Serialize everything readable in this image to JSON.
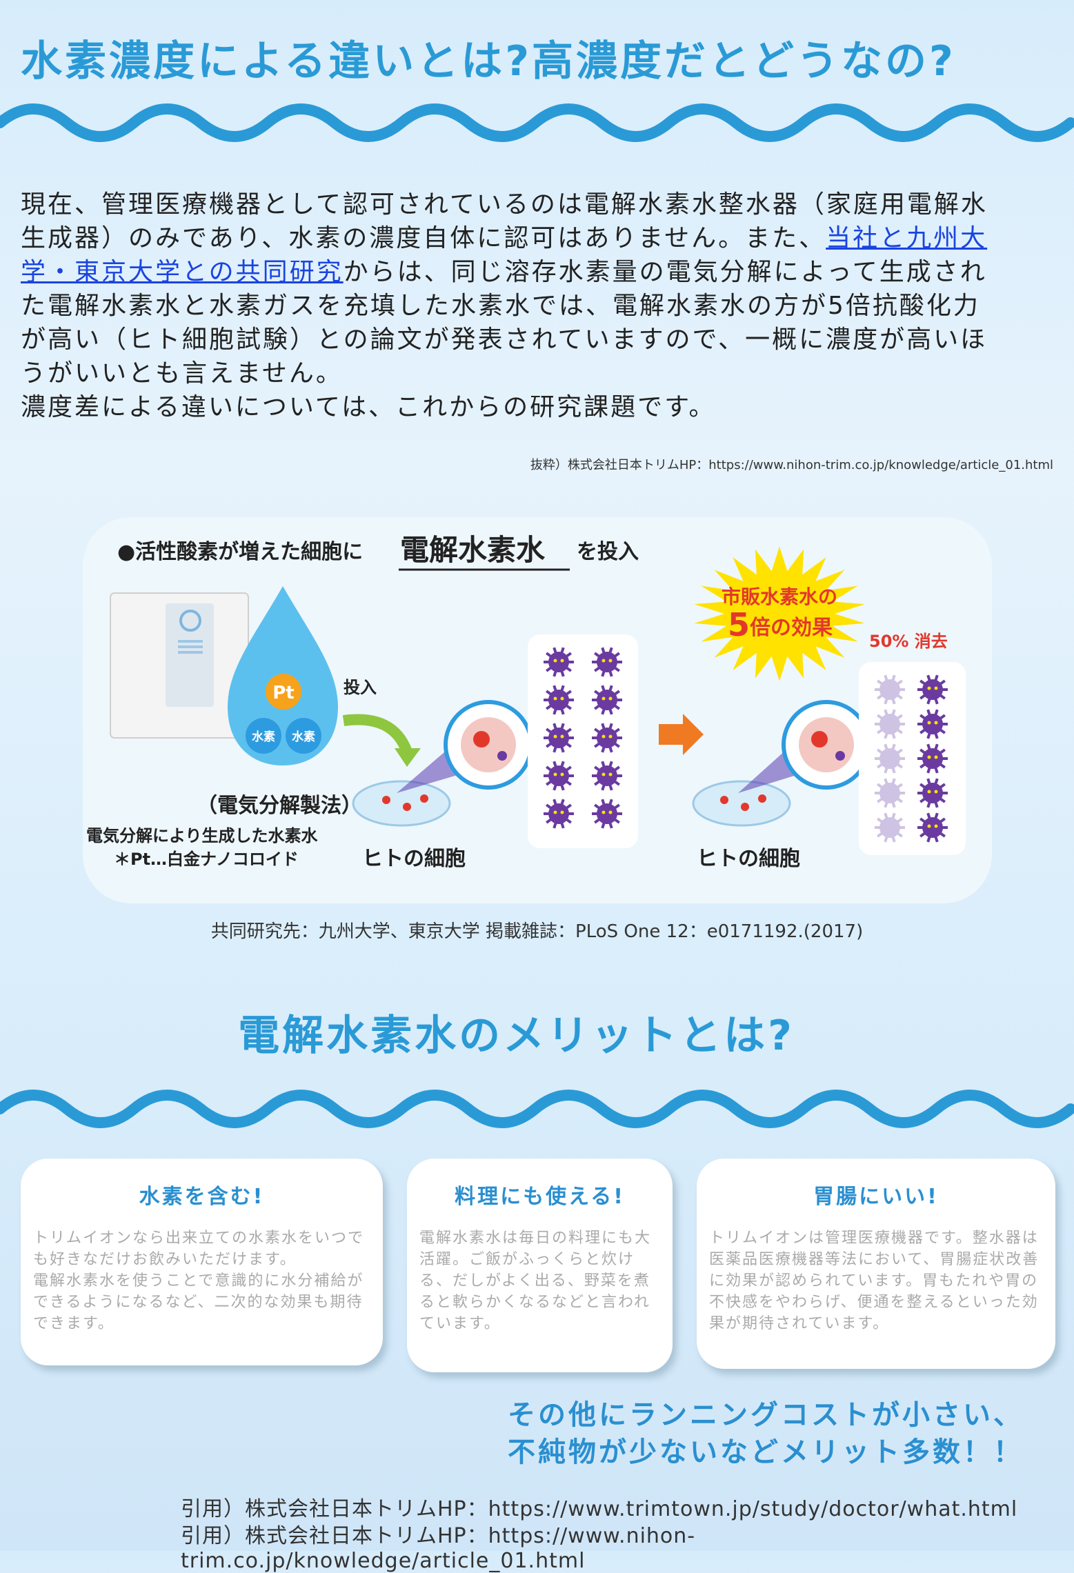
{
  "section1": {
    "title": "水素濃度による違いとは?高濃度だとどうなの?",
    "intro_before_link": "現在、管理医療機器として認可されているのは電解水素水整水器（家庭用電解水生成器）のみであり、水素の濃度自体に認可はありません。また、",
    "intro_link": "当社と九州大学・東京大学との共同研究",
    "intro_after_link": "からは、同じ溶存水素量の電気分解によって生成された電解水素水と水素ガスを充填した水素水では、電解水素水の方が5倍抗酸化力が高い（ヒト細胞試験）との論文が発表されていますので、一概に濃度が高いほうがいいとも言えません。",
    "intro_last_line": "濃度差による違いについては、これからの研究課題です。",
    "source": "抜粋）株式会社日本トリムHP：https://www.nihon-trim.co.jp/knowledge/article_01.html"
  },
  "infographic": {
    "headline_prefix": "●活性酸素が増えた細胞に",
    "headline_emph": "電解水素水",
    "headline_suffix": "を投入",
    "burst_line1": "市販水素水の",
    "burst_line2_num": "5",
    "burst_line2_rest": "倍の効果",
    "erase_label": "50% 消去",
    "pt_label": "Pt",
    "h2_label_1": "水素",
    "h2_label_2": "水素",
    "insert_label": "投入",
    "method_label": "（電気分解製法）",
    "method_note1": "電気分解により生成した水素水",
    "method_note2": "＊Pt…白金ナノコロイド",
    "cell_label_1": "ヒトの細胞",
    "cell_label_2": "ヒトの細胞",
    "colors": {
      "drop": "#5cc0ee",
      "burst": "#ffe200",
      "red": "#e2382c",
      "virus": "#6a3aa0",
      "arrow_green": "#8ec63f",
      "arrow_orange": "#f07a22"
    }
  },
  "caption": "共同研究先：九州大学、東京大学 掲載雑誌：PLoS One 12：e0171192.(2017)",
  "section2": {
    "title": "電解水素水のメリットとは?",
    "cards": [
      {
        "title": "水素を含む!",
        "body": "トリムイオンなら出来立ての水素水をいつでも好きなだけお飲みいただけます。\n電解水素水を使うことで意識的に水分補給ができるようになるなど、二次的な効果も期待できます。"
      },
      {
        "title": "料理にも使える!",
        "body": "電解水素水は毎日の料理にも大活躍。ご飯がふっくらと炊ける、だしがよく出る、野菜を煮ると軟らかくなるなどと言われています。"
      },
      {
        "title": "胃腸にいい!",
        "body": "トリムイオンは管理医療機器です。整水器は医薬品医療機器等法において、胃腸症状改善に効果が認められています。胃もたれや胃の不快感をやわらげ、便通を整えるといった効果が期待されています。"
      }
    ],
    "summary_line1": "その他にランニングコストが小さい、",
    "summary_line2": "不純物が少ないなどメリット多数！！",
    "citation1": "引用）株式会社日本トリムHP：https://www.trimtown.jp/study/doctor/what.html",
    "citation2": "引用）株式会社日本トリムHP：https://www.nihon-trim.co.jp/knowledge/article_01.html"
  }
}
